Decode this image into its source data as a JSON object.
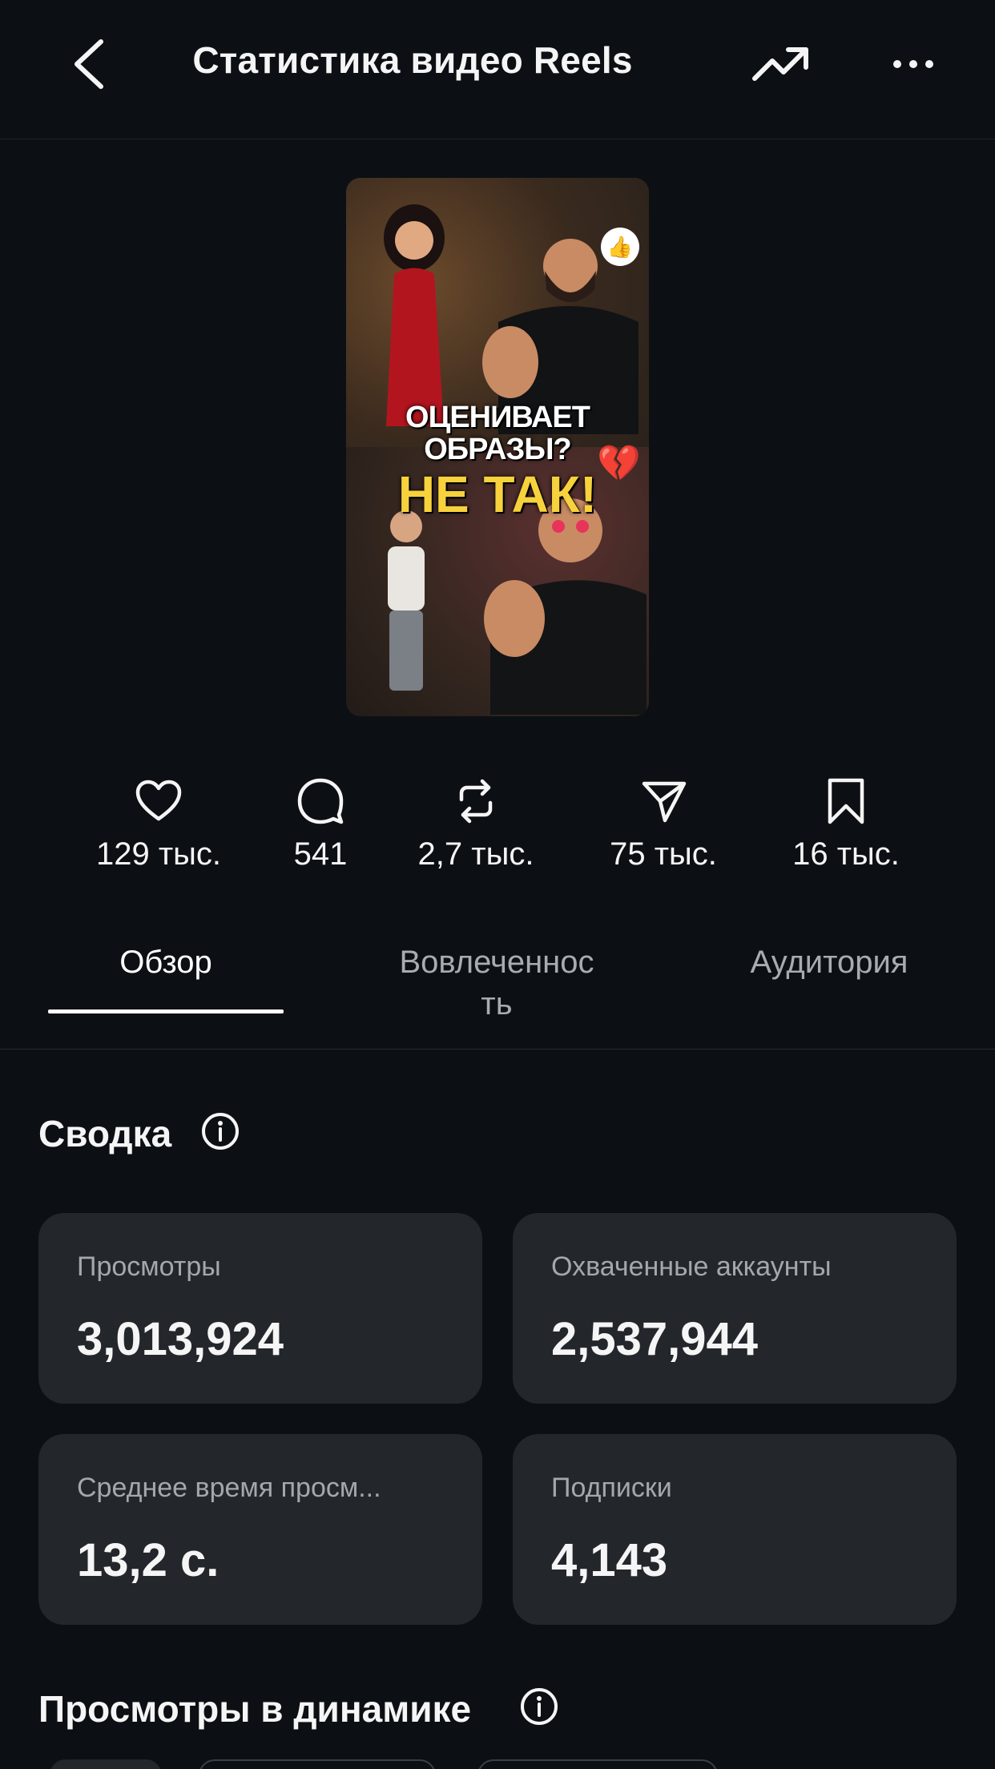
{
  "header": {
    "title": "Статистика видео Reels",
    "back_icon": "chevron-left-icon",
    "trend_icon": "trending-up-icon",
    "more_icon": "more-horizontal-icon"
  },
  "thumbnail": {
    "caption_line1": "ОЦЕНИВАЕТ ОБРАЗЫ?",
    "caption_line2": "НЕ ТАК!"
  },
  "stats": [
    {
      "icon": "heart-icon",
      "value": "129 тыс."
    },
    {
      "icon": "comment-icon",
      "value": "541"
    },
    {
      "icon": "repost-icon",
      "value": "2,7 тыс."
    },
    {
      "icon": "share-icon",
      "value": "75 тыс."
    },
    {
      "icon": "bookmark-icon",
      "value": "16 тыс."
    }
  ],
  "tabs": [
    {
      "label": "Обзор",
      "active": true
    },
    {
      "label": "Вовлеченнос\nть",
      "active": false
    },
    {
      "label": "Аудитория",
      "active": false
    }
  ],
  "summary": {
    "title": "Сводка",
    "cards": [
      {
        "label": "Просмотры",
        "value": "3,013,924"
      },
      {
        "label": "Охваченные аккаунты",
        "value": "2,537,944"
      },
      {
        "label": "Среднее время просм...",
        "value": "13,2 с."
      },
      {
        "label": "Подписки",
        "value": "4,143"
      }
    ]
  },
  "views_dynamics": {
    "title": "Просмотры в динамике"
  },
  "colors": {
    "background": "#0c1014",
    "card": "#23272c",
    "text_primary": "#f5f5f5",
    "text_secondary": "#a3a8ad"
  }
}
